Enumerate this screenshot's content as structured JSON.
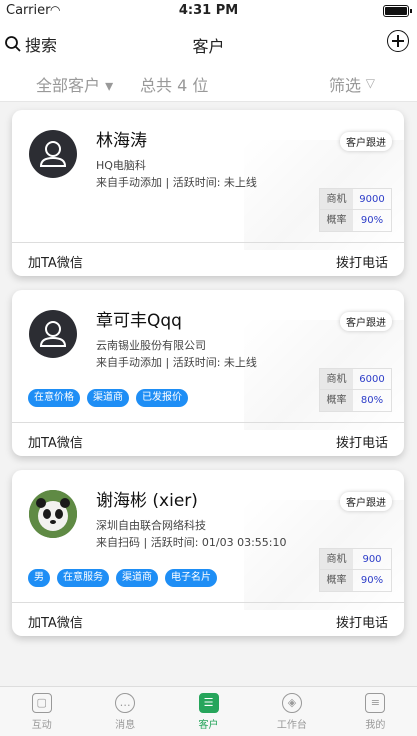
{
  "status_bar": {
    "carrier": "Carrier",
    "time": "4:31 PM"
  },
  "nav": {
    "search_label": "搜索",
    "title": "客户"
  },
  "filter_bar": {
    "all_customers": "全部客户 ▾",
    "total": "总共 4 位",
    "filter": "筛选"
  },
  "common": {
    "follow": "客户跟进",
    "add_wechat": "加TA微信",
    "call": "拨打电话",
    "opportunity_label": "商机",
    "probability_label": "概率"
  },
  "customers": [
    {
      "name": "林海涛",
      "company": "HQ电脑科",
      "source": "来自手动添加 | 活跃时间: 未上线",
      "opportunity": "9000",
      "probability": "90%",
      "tags": []
    },
    {
      "name": "章可丰Qqq",
      "company": "云南锡业股份有限公司",
      "source": "来自手动添加 | 活跃时间: 未上线",
      "opportunity": "6000",
      "probability": "80%",
      "tags": [
        "在意价格",
        "渠道商",
        "已发报价"
      ]
    },
    {
      "name": "谢海彬 (xier)",
      "company": "深圳自由联合网络科技",
      "source": "来自扫码 | 活跃时间: 01/03 03:55:10",
      "opportunity": "900",
      "probability": "90%",
      "tags": [
        "男",
        "在意服务",
        "渠道商",
        "电子名片"
      ]
    }
  ],
  "tabs": [
    {
      "label": "互动",
      "icon": "cube-icon"
    },
    {
      "label": "消息",
      "icon": "chat-icon"
    },
    {
      "label": "客户",
      "icon": "customer-card-icon"
    },
    {
      "label": "工作台",
      "icon": "compass-icon"
    },
    {
      "label": "我的",
      "icon": "profile-icon"
    }
  ],
  "colors": {
    "accent_green": "#26a55b",
    "tag_blue": "#1e8ef5",
    "stat_value_blue": "#2c3cc8"
  }
}
